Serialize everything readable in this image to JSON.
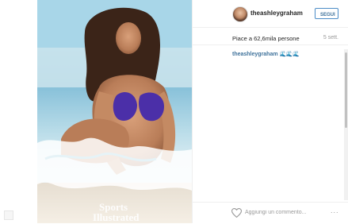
{
  "post": {
    "username": "theashleygraham",
    "follow_label": "SEGUI",
    "likes": "Piace a 62,6mila persone",
    "time": "5 sett.",
    "caption_author": "theashleygraham",
    "caption_waves": "🌊🌊🌊",
    "comment_placeholder": "Aggiungi un commento...",
    "more_label": "..."
  },
  "photo": {
    "watermark_line1": "Sports",
    "watermark_line2": "Illustrated"
  },
  "icons": [
    "heart-icon",
    "more-options-icon"
  ],
  "colors": {
    "link_blue": "#3f729b",
    "button_border": "#4d8dc7",
    "muted": "#999999",
    "bikini": "#4b2fa8"
  }
}
